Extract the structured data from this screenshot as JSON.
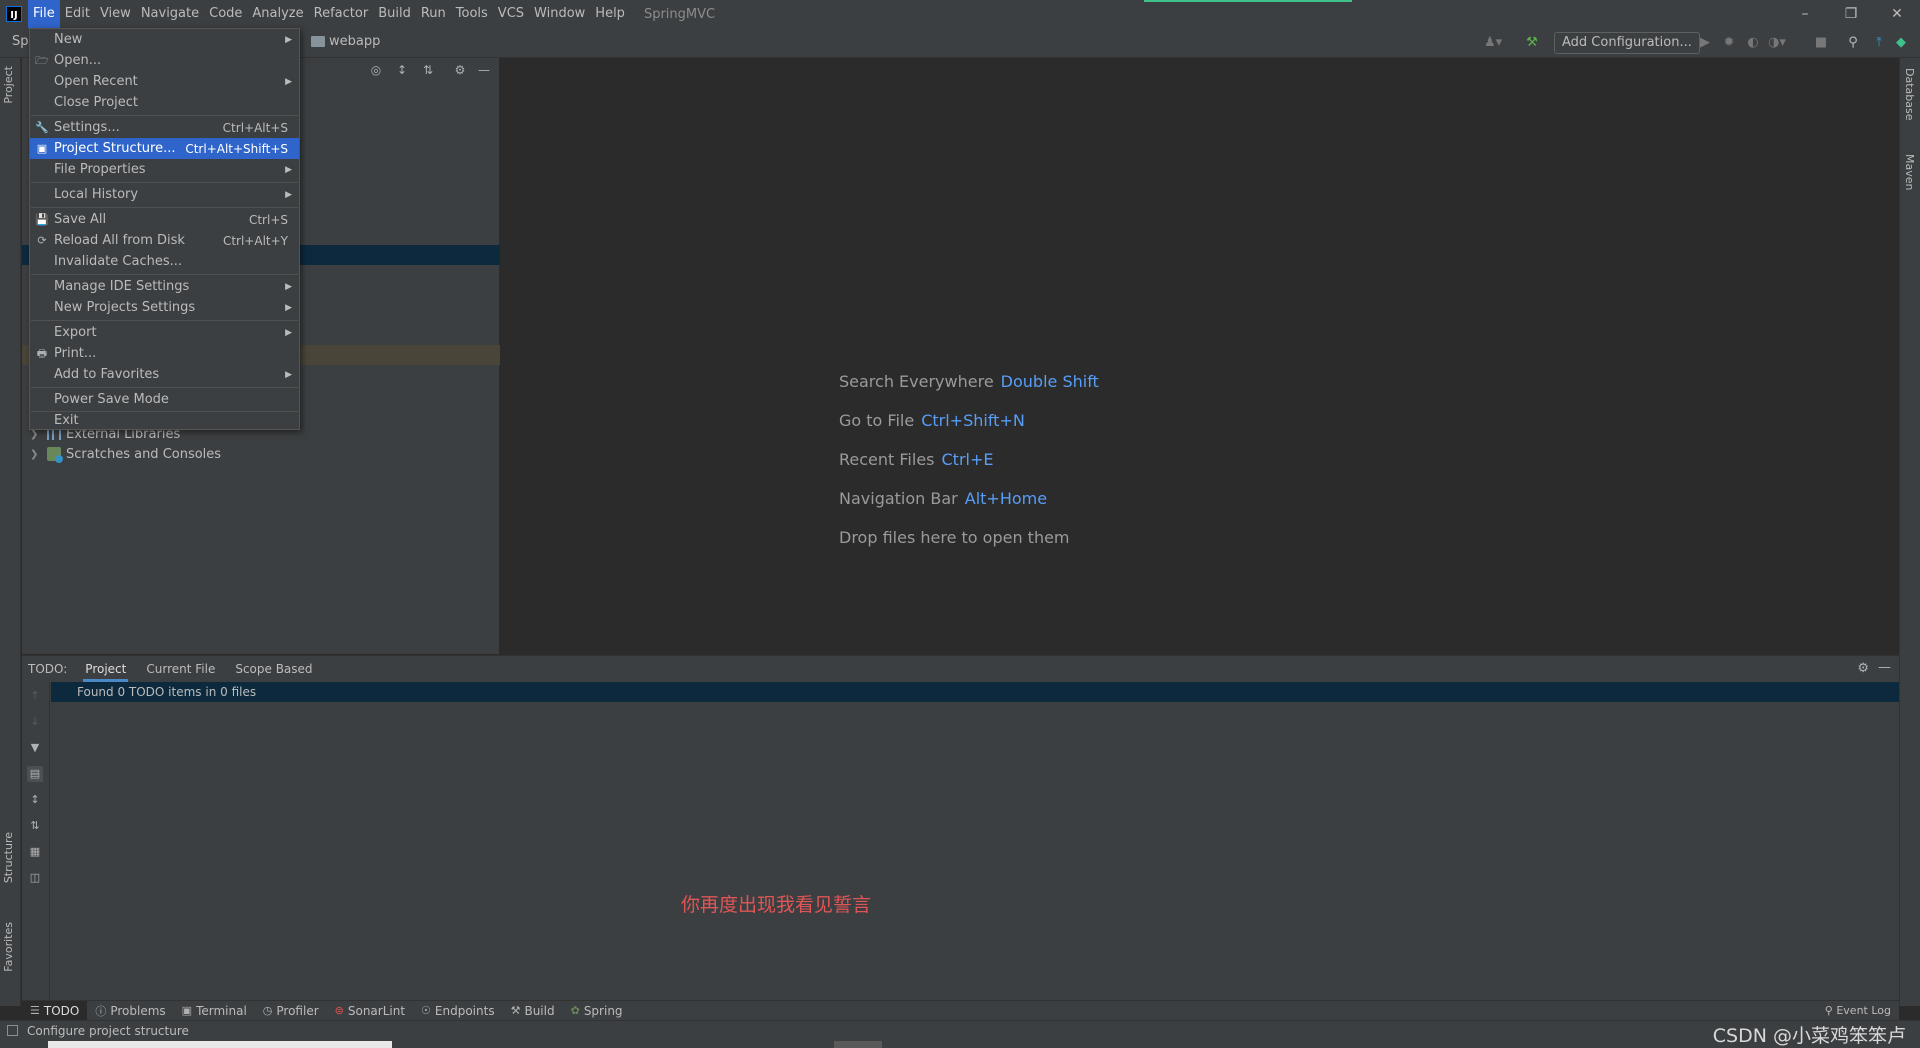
{
  "menubar": {
    "items": [
      "File",
      "Edit",
      "View",
      "Navigate",
      "Code",
      "Analyze",
      "Refactor",
      "Build",
      "Run",
      "Tools",
      "VCS",
      "Window",
      "Help"
    ],
    "project_name": "SpringMVC"
  },
  "toolbar": {
    "project_prefix": "Spi",
    "breadcrumb": "webapp",
    "add_configuration": "Add Configuration..."
  },
  "file_menu": {
    "items": [
      {
        "label": "New",
        "shortcut": "",
        "submenu": true
      },
      {
        "label": "Open...",
        "shortcut": "",
        "submenu": false
      },
      {
        "label": "Open Recent",
        "shortcut": "",
        "submenu": true
      },
      {
        "label": "Close Project",
        "shortcut": "",
        "submenu": false
      },
      {
        "label": "Settings...",
        "shortcut": "Ctrl+Alt+S",
        "submenu": false
      },
      {
        "label": "Project Structure...",
        "shortcut": "Ctrl+Alt+Shift+S",
        "submenu": false
      },
      {
        "label": "File Properties",
        "shortcut": "",
        "submenu": true
      },
      {
        "label": "Local History",
        "shortcut": "",
        "submenu": true
      },
      {
        "label": "Save All",
        "shortcut": "Ctrl+S",
        "submenu": false
      },
      {
        "label": "Reload All from Disk",
        "shortcut": "Ctrl+Alt+Y",
        "submenu": false
      },
      {
        "label": "Invalidate Caches...",
        "shortcut": "",
        "submenu": false
      },
      {
        "label": "Manage IDE Settings",
        "shortcut": "",
        "submenu": true
      },
      {
        "label": "New Projects Settings",
        "shortcut": "",
        "submenu": true
      },
      {
        "label": "Export",
        "shortcut": "",
        "submenu": true
      },
      {
        "label": "Print...",
        "shortcut": "",
        "submenu": false
      },
      {
        "label": "Add to Favorites",
        "shortcut": "",
        "submenu": true
      },
      {
        "label": "Power Save Mode",
        "shortcut": "",
        "submenu": false
      },
      {
        "label": "Exit",
        "shortcut": "",
        "submenu": false
      }
    ],
    "selected": "Project Structure..."
  },
  "project_tree": {
    "items": [
      {
        "label": "External Libraries",
        "icon": "library-icon"
      },
      {
        "label": "Scratches and Consoles",
        "icon": "scratches-icon"
      }
    ]
  },
  "editor_hints": [
    {
      "label": "Search Everywhere",
      "key": "Double Shift"
    },
    {
      "label": "Go to File",
      "key": "Ctrl+Shift+N"
    },
    {
      "label": "Recent Files",
      "key": "Ctrl+E"
    },
    {
      "label": "Navigation Bar",
      "key": "Alt+Home"
    },
    {
      "label": "Drop files here to open them",
      "key": ""
    }
  ],
  "todo": {
    "label": "TODO:",
    "tabs": [
      "Project",
      "Current File",
      "Scope Based"
    ],
    "active_tab": "Project",
    "found_text": "Found 0 TODO items in 0 files",
    "overlay_text": "你再度出现我看见誓言"
  },
  "side_tabs": {
    "left": [
      "Project",
      "Structure",
      "Favorites"
    ],
    "right": [
      "Database",
      "Maven"
    ]
  },
  "bottom_tools": [
    {
      "label": "TODO",
      "icon": "list-icon"
    },
    {
      "label": "Problems",
      "icon": "info-icon"
    },
    {
      "label": "Terminal",
      "icon": "terminal-icon"
    },
    {
      "label": "Profiler",
      "icon": "profiler-icon"
    },
    {
      "label": "SonarLint",
      "icon": "sonarlint-icon"
    },
    {
      "label": "Endpoints",
      "icon": "endpoints-icon"
    },
    {
      "label": "Build",
      "icon": "hammer-icon"
    },
    {
      "label": "Spring",
      "icon": "spring-icon"
    }
  ],
  "event_log": "Event Log",
  "status": {
    "text": "Configure project structure",
    "watermark": "CSDN @小菜鸡笨笨卢"
  },
  "colors": {
    "accent": "#2f65ca",
    "link": "#589df6",
    "selection": "#0d293e",
    "overlay_red": "#e05555"
  }
}
